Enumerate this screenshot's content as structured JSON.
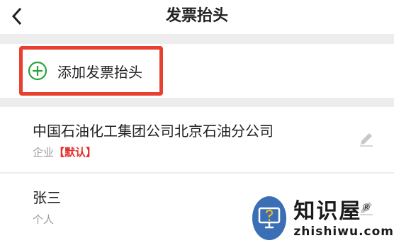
{
  "header": {
    "title": "发票抬头"
  },
  "add_action": {
    "label": "添加发票抬头"
  },
  "invoice_titles": [
    {
      "name": "中国石油化工集团公司北京石油分公司",
      "type": "企业",
      "default_tag": "【默认】"
    },
    {
      "name": "张三",
      "type": "个人"
    }
  ],
  "watermark": {
    "name": "知识屋",
    "registered_mark": "®",
    "url": "zhishiwu.com"
  },
  "icons": {
    "back": "chevron-left-icon",
    "add": "plus-circle-icon",
    "edit": "pencil-icon",
    "logo": "question-monitor-icon"
  },
  "colors": {
    "add_icon": "#2aa33a",
    "highlight_border": "#e8402e",
    "default_tag": "#e0302a",
    "watermark_circle": "#3a6fb5"
  }
}
